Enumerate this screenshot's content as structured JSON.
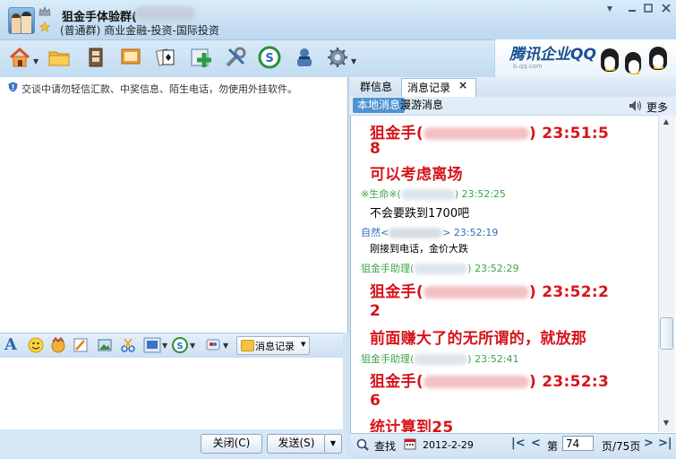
{
  "title": {
    "group_name": "狙金手体验群(",
    "description": "(普通群) 商业金融-投资-国际投资"
  },
  "ad": {
    "brand": "腾讯企业QQ",
    "sub": "b.qq.com"
  },
  "chat": {
    "notice": "交谈中请勿轻信汇款、中奖信息、陌生电话，勿使用外挂软件。"
  },
  "format_bar": {
    "font_glyph": "A",
    "history_button": "消息记录"
  },
  "buttons": {
    "close": "关闭(C)",
    "send": "发送(S)"
  },
  "tabs": {
    "group_info": "群信息",
    "history": "消息记录",
    "close_glyph": "×"
  },
  "subtabs": {
    "local": "本地消息",
    "roaming": "漫游消息",
    "more": "更多"
  },
  "colors": {
    "sender_green": "#3ba34a",
    "sender_blue": "#2f6fba",
    "highlight_red": "#d6141b"
  },
  "history": [
    {
      "kind": "big",
      "text": "狙金手(",
      "tail": ")  23:51:5"
    },
    {
      "kind": "big",
      "text": "8"
    },
    {
      "kind": "big",
      "text": "可以考虑离场"
    },
    {
      "kind": "meta",
      "sender": "※生命※(",
      "time": ") 23:52:25",
      "color": "green"
    },
    {
      "kind": "normal",
      "text": "不会要跌到1700吧"
    },
    {
      "kind": "meta",
      "sender": "自然<",
      "time": "> 23:52:19",
      "color": "blue"
    },
    {
      "kind": "small",
      "text": "刚接到电话，金价大跌"
    },
    {
      "kind": "meta",
      "sender": "狙金手助理(",
      "time": ") 23:52:29",
      "color": "green"
    },
    {
      "kind": "big",
      "text": "狙金手(",
      "tail": ")  23:52:2"
    },
    {
      "kind": "big",
      "text": "2"
    },
    {
      "kind": "big",
      "text": "前面赚大了的无所谓的，就放那"
    },
    {
      "kind": "meta",
      "sender": "狙金手助理(",
      "time": ") 23:52:41",
      "color": "green"
    },
    {
      "kind": "big",
      "text": "狙金手(",
      "tail": ")  23:52:3"
    },
    {
      "kind": "big",
      "text": "6"
    },
    {
      "kind": "big",
      "text": "统计算到25"
    }
  ],
  "footer": {
    "search": "查找",
    "date": "2012-2-29",
    "page_word": "第",
    "page_value": "74",
    "page_total": "页/75页"
  }
}
